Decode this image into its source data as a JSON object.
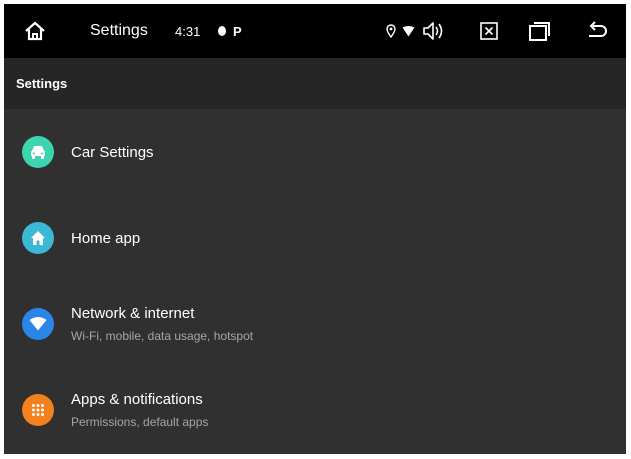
{
  "status_bar": {
    "app_title": "Settings",
    "clock": "4:31",
    "p_badge": "P"
  },
  "action_bar": {
    "title": "Settings"
  },
  "colors": {
    "car_icon": "#3fd4b0",
    "home_icon": "#3bb8d6",
    "network_icon": "#2a86e8",
    "apps_icon": "#f4801f"
  },
  "settings_items": [
    {
      "title": "Car Settings",
      "subtitle": "",
      "icon": "car-icon"
    },
    {
      "title": "Home app",
      "subtitle": "",
      "icon": "home-icon"
    },
    {
      "title": "Network & internet",
      "subtitle": "Wi-Fi, mobile, data usage, hotspot",
      "icon": "wifi-icon"
    },
    {
      "title": "Apps & notifications",
      "subtitle": "Permissions, default apps",
      "icon": "apps-grid-icon"
    }
  ]
}
